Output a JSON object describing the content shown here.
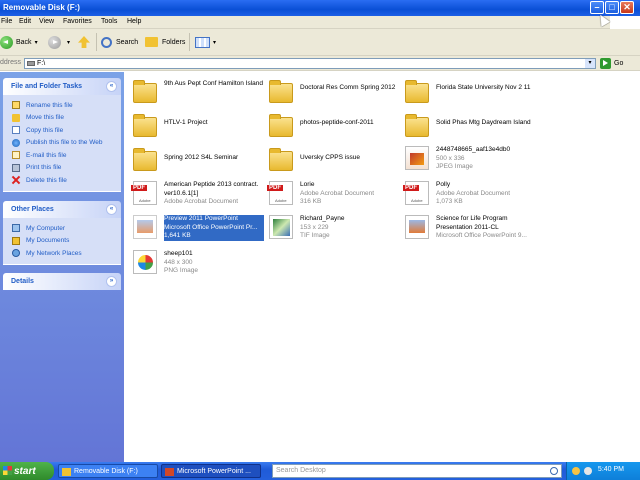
{
  "window": {
    "title": "Removable Disk (F:)",
    "min_glyph": "–",
    "max_glyph": "□",
    "close_glyph": "✕"
  },
  "menu": [
    "File",
    "Edit",
    "View",
    "Favorites",
    "Tools",
    "Help"
  ],
  "toolbar": {
    "back_label": "Back",
    "search_label": "Search",
    "folders_label": "Folders",
    "dropdown_glyph": "▾"
  },
  "address": {
    "label": "ddress",
    "value": "F:\\",
    "go_label": "Go",
    "dropdown_glyph": "▾"
  },
  "taskpane": {
    "file_tasks": {
      "title": "File and Folder Tasks",
      "collapse_glyph": "«",
      "items": [
        {
          "label": "Rename this file",
          "icon": "rename-icon"
        },
        {
          "label": "Move this file",
          "icon": "move-icon"
        },
        {
          "label": "Copy this file",
          "icon": "copy-icon"
        },
        {
          "label": "Publish this file to the Web",
          "icon": "web-icon"
        },
        {
          "label": "E-mail this file",
          "icon": "email-icon"
        },
        {
          "label": "Print this file",
          "icon": "print-icon"
        },
        {
          "label": "Delete this file",
          "icon": "delete-icon"
        }
      ]
    },
    "other_places": {
      "title": "Other Places",
      "collapse_glyph": "«",
      "items": [
        {
          "label": "My Computer",
          "icon": "my-computer-icon"
        },
        {
          "label": "My Documents",
          "icon": "my-documents-icon"
        },
        {
          "label": "My Network Places",
          "icon": "my-network-icon"
        }
      ]
    },
    "details": {
      "title": "Details",
      "expand_glyph": "»"
    }
  },
  "files": [
    {
      "name": "9th Aus Pept Conf Hamilton Island",
      "sub1": "",
      "sub2": "",
      "type": "folder"
    },
    {
      "name": "Doctoral Res Comm Spring 2012",
      "sub1": "",
      "sub2": "",
      "type": "folder"
    },
    {
      "name": "Florida State University Nov 2 11",
      "sub1": "",
      "sub2": "",
      "type": "folder"
    },
    {
      "name": "HTLV-1 Project",
      "sub1": "",
      "sub2": "",
      "type": "folder"
    },
    {
      "name": "photos-peptide-conf-2011",
      "sub1": "",
      "sub2": "",
      "type": "folder"
    },
    {
      "name": "Solid Phas Mtg Daydream Island",
      "sub1": "",
      "sub2": "",
      "type": "folder"
    },
    {
      "name": "Spring 2012 S4L Seminar",
      "sub1": "",
      "sub2": "",
      "type": "folder"
    },
    {
      "name": "Uversky CPPS issue",
      "sub1": "",
      "sub2": "",
      "type": "folder"
    },
    {
      "name": "2448748665_aaf13e4db0",
      "sub1": "500 x 336",
      "sub2": "JPEG Image",
      "type": "jpg"
    },
    {
      "name": "American Peptide 2013 contract. ver10.6.1[1]",
      "sub1": "Adobe Acrobat Document",
      "sub2": "",
      "type": "pdf"
    },
    {
      "name": "Lorie",
      "sub1": "Adobe Acrobat Document",
      "sub2": "316 KB",
      "type": "pdf"
    },
    {
      "name": "Polly",
      "sub1": "Adobe Acrobat Document",
      "sub2": "1,073 KB",
      "type": "pdf"
    },
    {
      "name": "Preview 2011 PowerPoint",
      "sub1": "Microsoft Office PowerPoint Pr...",
      "sub2": "1,641 KB",
      "type": "ppt",
      "selected": true
    },
    {
      "name": "Richard_Payne",
      "sub1": "153 x 229",
      "sub2": "TIF Image",
      "type": "tif"
    },
    {
      "name": "Science for Life Program Presentation 2011-CL",
      "sub1": "Microsoft Office PowerPoint 9...",
      "sub2": "",
      "type": "ppt"
    },
    {
      "name": "sheep101",
      "sub1": "448 x 300",
      "sub2": "PNG Image",
      "type": "png"
    }
  ],
  "icon_labels": {
    "pdf_badge": "PDF",
    "adobe": "Adobe"
  },
  "taskbar": {
    "start_label": "start",
    "tasks": [
      {
        "label": "Removable Disk (F:)"
      },
      {
        "label": "Microsoft PowerPoint ..."
      }
    ],
    "search_placeholder": "Search Desktop",
    "clock": "5:40 PM"
  }
}
